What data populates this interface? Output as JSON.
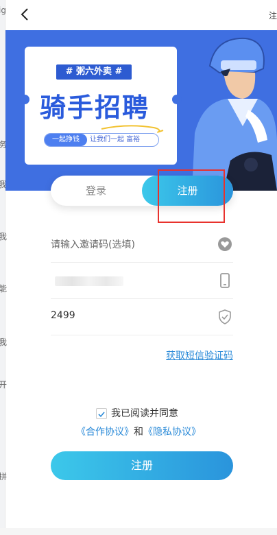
{
  "background_fragments": [
    "ig",
    "务",
    "我",
    "我",
    "能",
    "我",
    "开",
    "拼"
  ],
  "nav": {
    "right_text": "注"
  },
  "banner": {
    "tag": "# 粥六外卖 #",
    "headline": "骑手招聘",
    "pill_left": "一起挣钱",
    "pill_right": "让我们一起 富裕"
  },
  "tabs": {
    "login": "登录",
    "register": "注册"
  },
  "form": {
    "invite_placeholder": "请输入邀请码(选填)",
    "code_value": "2499",
    "sms_link": "获取短信验证码"
  },
  "agreement": {
    "label": "我已阅读并同意",
    "link_contract": "《合作协议》",
    "and": "和",
    "link_privacy": "《隐私协议》"
  },
  "submit_label": "注册",
  "colors": {
    "brand_blue": "#3f6fe1",
    "gradient_start": "#3cc8ea",
    "gradient_end": "#2a94dc",
    "highlight_box": "#e8322d"
  }
}
